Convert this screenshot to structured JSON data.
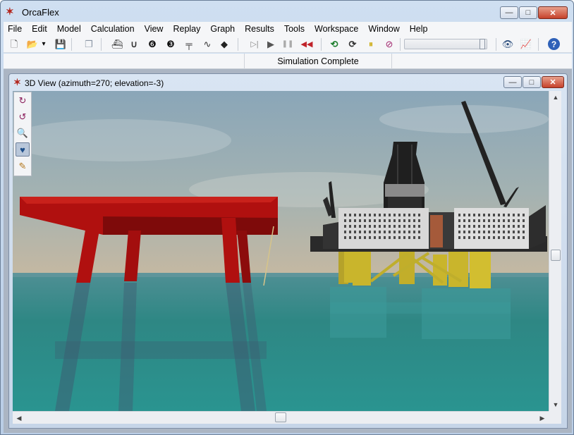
{
  "app": {
    "title": "OrcaFlex"
  },
  "window_buttons": {
    "minimize": "—",
    "maximize": "□",
    "close": "✕"
  },
  "menu": [
    "File",
    "Edit",
    "Model",
    "Calculation",
    "View",
    "Replay",
    "Graph",
    "Results",
    "Tools",
    "Workspace",
    "Window",
    "Help"
  ],
  "toolbar": {
    "icons": [
      {
        "name": "new-icon",
        "glyph": "🗋"
      },
      {
        "name": "open-icon",
        "glyph": "📂"
      },
      {
        "name": "dropdown-arrow-icon",
        "glyph": "▾"
      },
      {
        "name": "save-icon",
        "glyph": "💾"
      },
      {
        "name": "copy-icon",
        "glyph": "❐"
      },
      {
        "name": "vessel-icon",
        "glyph": "⛴"
      },
      {
        "name": "line-icon",
        "glyph": "∪"
      },
      {
        "name": "6d-buoy-icon",
        "glyph": "❻"
      },
      {
        "name": "3d-buoy-icon",
        "glyph": "❸"
      },
      {
        "name": "winch-icon",
        "glyph": "╤"
      },
      {
        "name": "link-icon",
        "glyph": "∿"
      },
      {
        "name": "shape-icon",
        "glyph": "◆"
      },
      {
        "name": "step-forward-icon",
        "glyph": "▷|"
      },
      {
        "name": "run-icon",
        "glyph": "▶"
      },
      {
        "name": "pause-icon",
        "glyph": "❚❚"
      },
      {
        "name": "reset-icon",
        "glyph": "◀◀"
      },
      {
        "name": "replay-start-icon",
        "glyph": "⟲"
      },
      {
        "name": "replay-step-icon",
        "glyph": "⟳"
      },
      {
        "name": "replay-pause-icon",
        "glyph": "⏸"
      },
      {
        "name": "replay-stop-icon",
        "glyph": "⊘"
      },
      {
        "name": "view-icon",
        "glyph": "👁"
      },
      {
        "name": "graph-icon",
        "glyph": "📈"
      },
      {
        "name": "help-icon",
        "glyph": "?"
      }
    ],
    "replay_slider_position": 1.0
  },
  "status": {
    "text": "Simulation Complete"
  },
  "child_window": {
    "title": "3D View (azimuth=270; elevation=-3)"
  },
  "view_palette": [
    {
      "name": "rotate-up-icon",
      "glyph": "↻"
    },
    {
      "name": "rotate-left-icon",
      "glyph": "↺"
    },
    {
      "name": "zoom-icon",
      "glyph": "🔍"
    },
    {
      "name": "view-mode-icon",
      "glyph": "♥"
    },
    {
      "name": "edit-view-icon",
      "glyph": "✎"
    }
  ],
  "colors": {
    "structure_red": "#b0100f",
    "sea": "#2f8a8a",
    "sky": "#7c96a6",
    "hull_white": "#d9d9d9",
    "pontoon_yellow": "#c9b52c"
  }
}
